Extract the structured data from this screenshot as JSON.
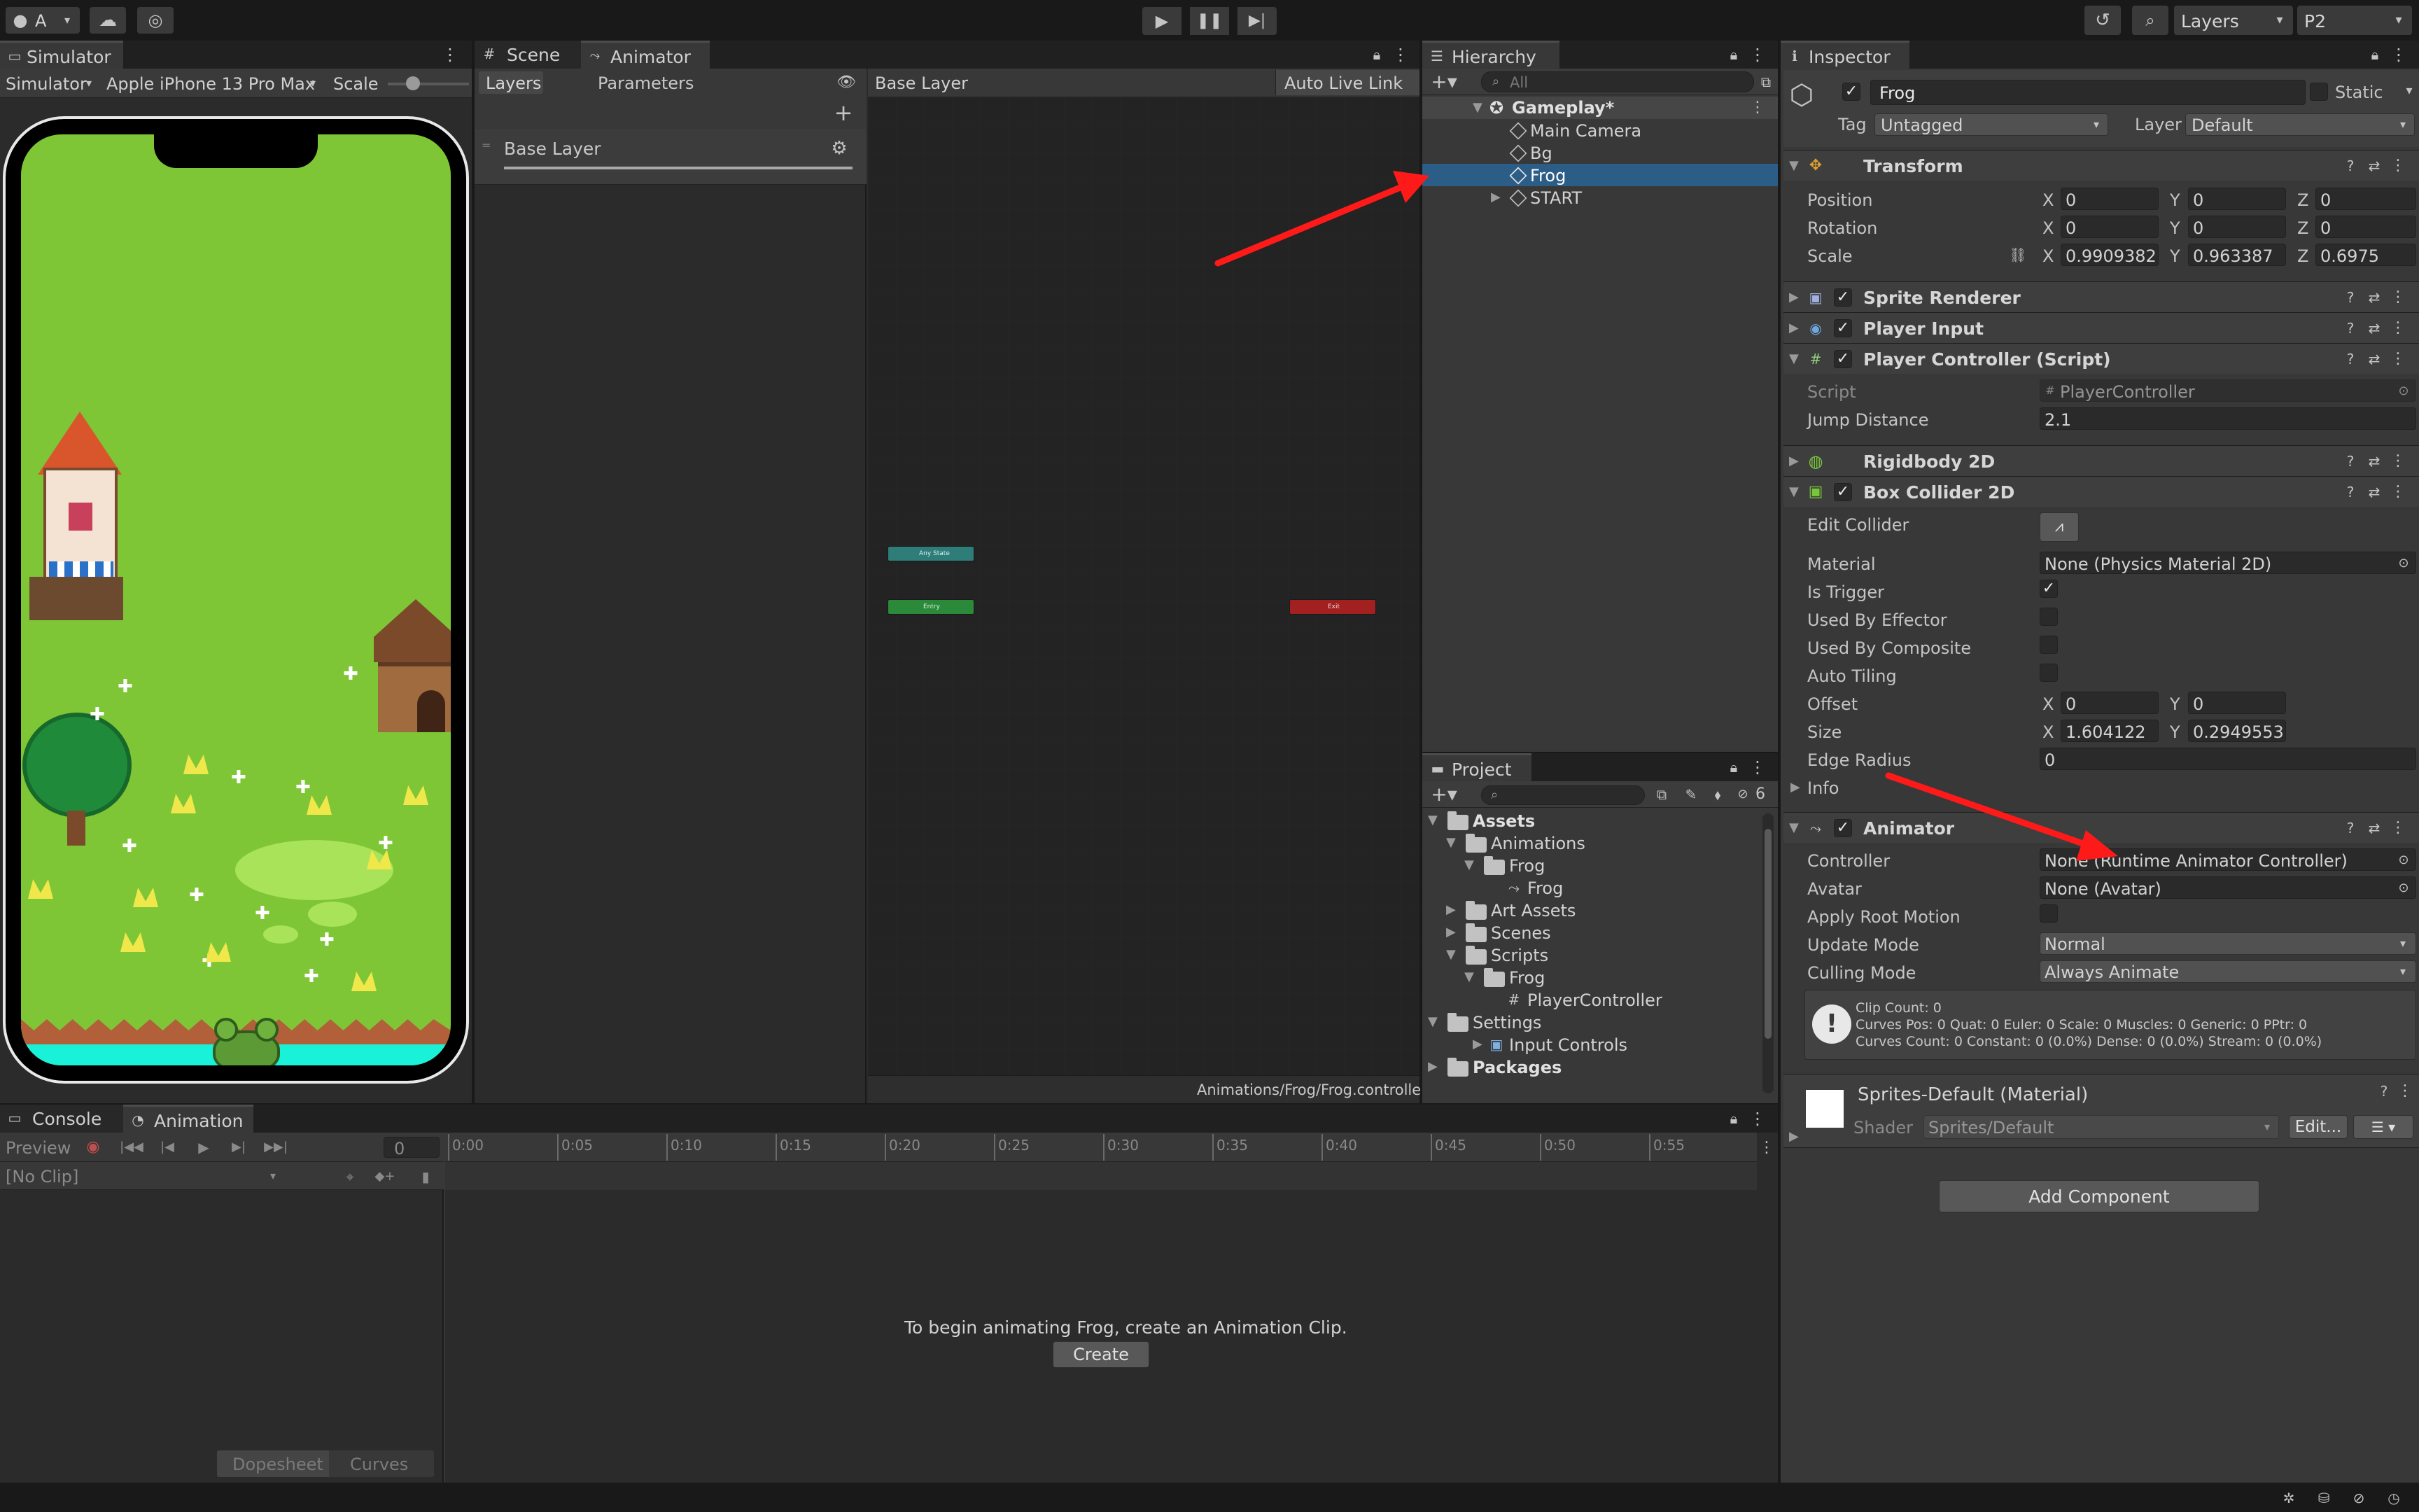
{
  "toolbar": {
    "account_label": "A",
    "layers_label": "Layers",
    "layout_label": "P2"
  },
  "simulator": {
    "tab": "Simulator",
    "mode": "Simulator",
    "device": "Apple iPhone 13 Pro Max",
    "scale_label": "Scale"
  },
  "scene_tab": "Scene",
  "animator": {
    "tab": "Animator",
    "layers_tab": "Layers",
    "parameters_tab": "Parameters",
    "breadcrumb": "Base Layer",
    "auto_live_link": "Auto Live Link",
    "layer_name": "Base Layer",
    "any_state": "Any State",
    "entry": "Entry",
    "exit": "Exit",
    "footer_path": "Animations/Frog/Frog.controller"
  },
  "hierarchy": {
    "tab": "Hierarchy",
    "search_placeholder": "All",
    "items": [
      {
        "label": "Gameplay*"
      },
      {
        "label": "Main Camera"
      },
      {
        "label": "Bg"
      },
      {
        "label": "Frog"
      },
      {
        "label": "START"
      }
    ]
  },
  "project": {
    "tab": "Project",
    "hidden_count": "6",
    "tree": [
      {
        "label": "Assets"
      },
      {
        "label": "Animations"
      },
      {
        "label": "Frog"
      },
      {
        "label": "Frog"
      },
      {
        "label": "Art Assets"
      },
      {
        "label": "Scenes"
      },
      {
        "label": "Scripts"
      },
      {
        "label": "Frog"
      },
      {
        "label": "PlayerController"
      },
      {
        "label": "Settings"
      },
      {
        "label": "Input Controls"
      },
      {
        "label": "Packages"
      }
    ]
  },
  "inspector": {
    "tab": "Inspector",
    "object_name": "Frog",
    "static_label": "Static",
    "tag_label": "Tag",
    "tag_value": "Untagged",
    "layer_label": "Layer",
    "layer_value": "Default",
    "transform": {
      "title": "Transform",
      "position_label": "Position",
      "rotation_label": "Rotation",
      "scale_label": "Scale",
      "x": "X",
      "y": "Y",
      "z": "Z",
      "position": [
        "0",
        "0",
        "0"
      ],
      "rotation": [
        "0",
        "0",
        "0"
      ],
      "scale": [
        "0.9909382",
        "0.963387",
        "0.6975"
      ]
    },
    "sprite_renderer": "Sprite Renderer",
    "player_input": "Player Input",
    "player_controller": {
      "title": "Player Controller (Script)",
      "script_label": "Script",
      "script_value": "PlayerController",
      "jump_label": "Jump Distance",
      "jump_value": "2.1"
    },
    "rigidbody": "Rigidbody 2D",
    "box_collider": {
      "title": "Box Collider 2D",
      "edit_collider": "Edit Collider",
      "material_label": "Material",
      "material_value": "None (Physics Material 2D)",
      "is_trigger": "Is Trigger",
      "used_by_effector": "Used By Effector",
      "used_by_composite": "Used By Composite",
      "auto_tiling": "Auto Tiling",
      "offset_label": "Offset",
      "offset": [
        "0",
        "0"
      ],
      "size_label": "Size",
      "size": [
        "1.604122",
        "0.2949553"
      ],
      "edge_radius_label": "Edge Radius",
      "edge_radius": "0",
      "info": "Info"
    },
    "animator": {
      "title": "Animator",
      "controller_label": "Controller",
      "controller_value": "None (Runtime Animator Controller)",
      "avatar_label": "Avatar",
      "avatar_value": "None (Avatar)",
      "apply_root_motion": "Apply Root Motion",
      "update_mode_label": "Update Mode",
      "update_mode_value": "Normal",
      "culling_mode_label": "Culling Mode",
      "culling_mode_value": "Always Animate",
      "info_line1": "Clip Count: 0",
      "info_line2": "Curves Pos: 0 Quat: 0 Euler: 0 Scale: 0 Muscles: 0 Generic: 0 PPtr: 0",
      "info_line3": "Curves Count: 0 Constant: 0 (0.0%) Dense: 0 (0.0%) Stream: 0 (0.0%)"
    },
    "material": {
      "title": "Sprites-Default (Material)",
      "shader_label": "Shader",
      "shader_value": "Sprites/Default",
      "edit_button": "Edit..."
    },
    "add_component": "Add Component"
  },
  "animation": {
    "console_tab": "Console",
    "animation_tab": "Animation",
    "preview": "Preview",
    "frame": "0",
    "clip": "[No Clip]",
    "ticks": [
      "0:00",
      "0:05",
      "0:10",
      "0:15",
      "0:20",
      "0:25",
      "0:30",
      "0:35",
      "0:40",
      "0:45",
      "0:50",
      "0:55"
    ],
    "message": "To begin animating Frog, create an Animation Clip.",
    "create_button": "Create",
    "dopesheet": "Dopesheet",
    "curves": "Curves"
  },
  "colors": {
    "accent": "#2c5d87",
    "arrow": "#ff1a1a",
    "grass": "#7ec636",
    "water": "#19f2d9",
    "any_state": "#2f7d78",
    "entry": "#2a8a3a",
    "exit": "#a32020"
  }
}
